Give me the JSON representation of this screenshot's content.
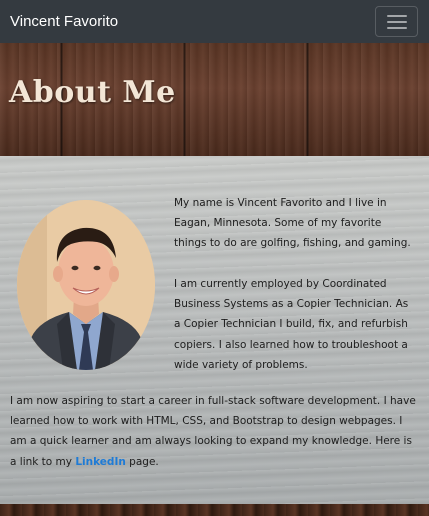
{
  "navbar": {
    "brand": "Vincent Favorito",
    "toggle_icon": "hamburger-icon"
  },
  "header": {
    "title": "About Me"
  },
  "profile": {
    "photo": "profile-photo"
  },
  "bio": {
    "paragraph1": "My name is Vincent Favorito and I live in Eagan, Minnesota. Some of my favorite things to do are golfing, fishing, and gaming.",
    "paragraph2": "I am currently employed by Coordinated Business Systems as a Copier Technician. As a Copier Technician I build, fix, and refurbish copiers. I also learned how to troubleshoot a wide variety of problems.",
    "paragraph3_before": "I am now aspiring to start a career in full-stack software development. I have learned how to work with HTML, CSS, and Bootstrap to design webpages. I am a quick learner and am always looking to expand my knowledge. Here is a link to my ",
    "paragraph3_link": "LinkedIn",
    "paragraph3_after": " page."
  },
  "colors": {
    "navbar": "#343a40",
    "link": "#1e7bd6",
    "title": "#f3e6d6"
  }
}
